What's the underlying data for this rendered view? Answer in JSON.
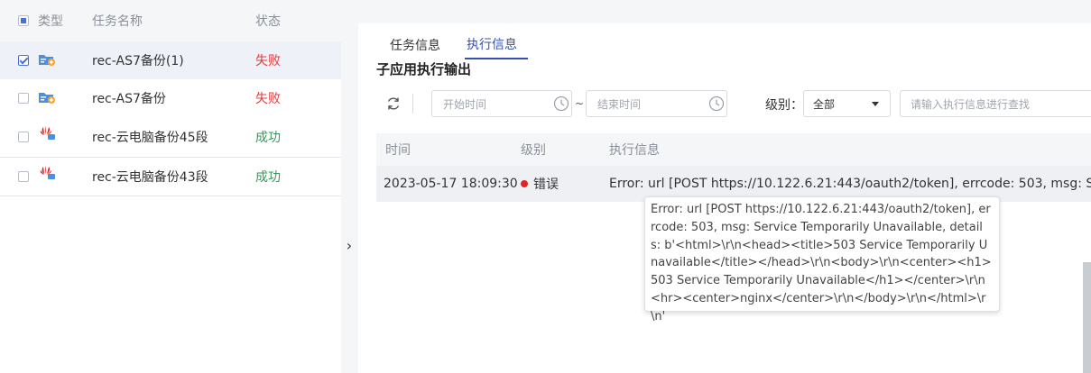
{
  "task_list": {
    "columns": {
      "type": "类型",
      "name": "任务名称",
      "status": "状态"
    },
    "rows": [
      {
        "icon": "as-backup-icon",
        "name": "rec-AS7备份(1)",
        "status": "失败",
        "selected": true,
        "checked": true
      },
      {
        "icon": "as-backup-icon",
        "name": "rec-AS7备份",
        "status": "失败",
        "selected": false,
        "checked": false
      },
      {
        "icon": "huawei-cloud-pc-icon",
        "name": "rec-云电脑备份45段",
        "status": "成功",
        "selected": false,
        "checked": false
      },
      {
        "icon": "huawei-cloud-pc-icon",
        "name": "rec-云电脑备份43段",
        "status": "成功",
        "selected": false,
        "checked": false
      }
    ]
  },
  "expand_handle": {
    "glyph": "›"
  },
  "detail": {
    "tabs": [
      {
        "label": "任务信息",
        "active": false
      },
      {
        "label": "执行信息",
        "active": true
      }
    ],
    "section_title": "子应用执行输出",
    "filters": {
      "start_placeholder": "开始时间",
      "separator": "~",
      "end_placeholder": "结束时间",
      "level_label": "级别：",
      "level_value": "全部",
      "search_placeholder": "请输入执行信息进行查找"
    },
    "table": {
      "columns": {
        "time": "时间",
        "level": "级别",
        "message": "执行信息"
      },
      "rows": [
        {
          "time": "2023-05-17 18:09:30",
          "level": "错误",
          "message": "Error: url [POST https://10.122.6.21:443/oauth2/token], errcode: 503, msg: Service Temporarily Unavailable"
        }
      ]
    },
    "tooltip": {
      "text": "Error: url [POST https://10.122.6.21:443/oauth2/token], errcode: 503, msg: Service Temporarily Unavailable, details: b'<html>\\r\\n<head><title>503 Service Temporarily Unavailable</title></head>\\r\\n<body>\\r\\n<center><h1>503 Service Temporarily Unavailable</h1></center>\\r\\n<hr><center>nginx</center>\\r\\n</body>\\r\\n</html>\\r\\n'"
    }
  },
  "colors": {
    "accent": "#3451b2",
    "fail": "#e33c3c",
    "success": "#2f9a5a",
    "error_dot": "#e02424"
  }
}
